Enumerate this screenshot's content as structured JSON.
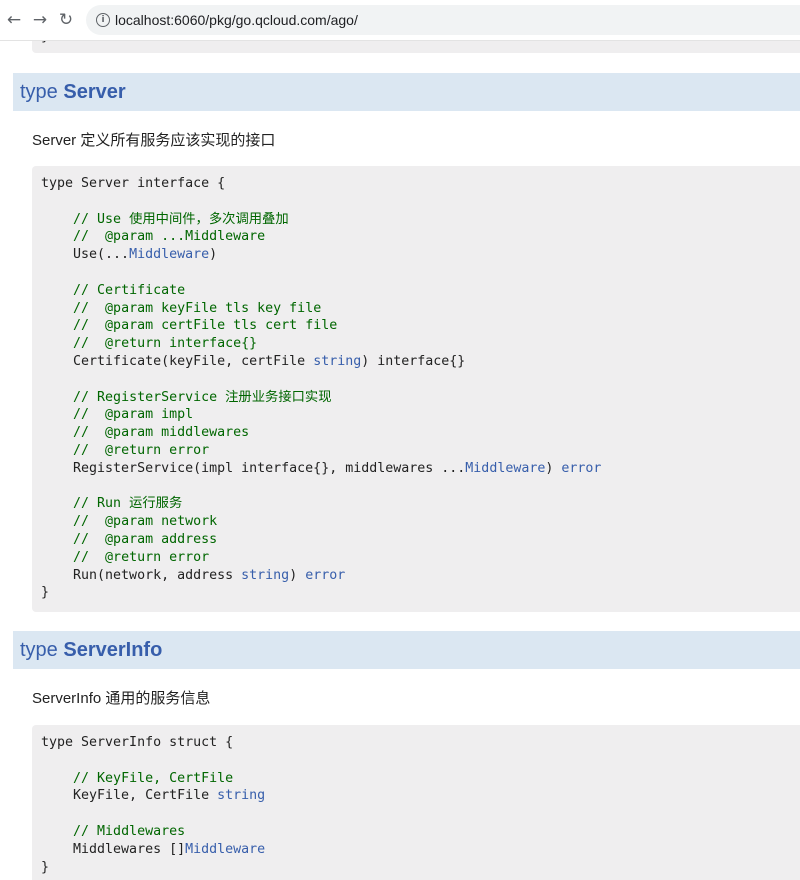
{
  "browser": {
    "back_icon": "arrow-left",
    "forward_icon": "arrow-right",
    "reload_icon": "reload",
    "url": "localhost:6060/pkg/go.qcloud.com/ago/"
  },
  "prev_block": {
    "closing": "}"
  },
  "server": {
    "keyword": "type",
    "name": "Server",
    "description": "Server 定义所有服务应该实现的接口",
    "code": [
      {
        "t": "type Server interface {"
      },
      {
        "t": ""
      },
      {
        "t": "    ",
        "c": "// Use 使用中间件，多次调用叠加"
      },
      {
        "t": "    ",
        "c": "//  @param ...Middleware"
      },
      {
        "t": "    Use(...",
        "l": "Middleware",
        "r": ")"
      },
      {
        "t": ""
      },
      {
        "t": "    ",
        "c": "// Certificate"
      },
      {
        "t": "    ",
        "c": "//  @param keyFile tls key file"
      },
      {
        "t": "    ",
        "c": "//  @param certFile tls cert file"
      },
      {
        "t": "    ",
        "c": "//  @return interface{}"
      },
      {
        "t": "    Certificate(keyFile, certFile ",
        "l": "string",
        "r": ") interface{}"
      },
      {
        "t": ""
      },
      {
        "t": "    ",
        "c": "// RegisterService 注册业务接口实现"
      },
      {
        "t": "    ",
        "c": "//  @param impl"
      },
      {
        "t": "    ",
        "c": "//  @param middlewares"
      },
      {
        "t": "    ",
        "c": "//  @return error"
      },
      {
        "t": "    RegisterService(impl interface{}, middlewares ...",
        "l": "Middleware",
        "r": ") ",
        "l2": "error"
      },
      {
        "t": ""
      },
      {
        "t": "    ",
        "c": "// Run 运行服务"
      },
      {
        "t": "    ",
        "c": "//  @param network"
      },
      {
        "t": "    ",
        "c": "//  @param address"
      },
      {
        "t": "    ",
        "c": "//  @return error"
      },
      {
        "t": "    Run(network, address ",
        "l": "string",
        "r": ") ",
        "l2": "error"
      },
      {
        "t": "}"
      }
    ]
  },
  "serverinfo": {
    "keyword": "type",
    "name": "ServerInfo",
    "description": "ServerInfo 通用的服务信息",
    "code": [
      {
        "t": "type ServerInfo struct {"
      },
      {
        "t": ""
      },
      {
        "t": "    ",
        "c": "// KeyFile, CertFile"
      },
      {
        "t": "    KeyFile, CertFile ",
        "l": "string"
      },
      {
        "t": ""
      },
      {
        "t": "    ",
        "c": "// Middlewares"
      },
      {
        "t": "    Middlewares []",
        "l": "Middleware"
      },
      {
        "t": "}"
      }
    ]
  },
  "colors": {
    "header_bg": "#dbe7f2",
    "code_bg": "#efeeef",
    "comment": "#006600",
    "link": "#375eab"
  }
}
